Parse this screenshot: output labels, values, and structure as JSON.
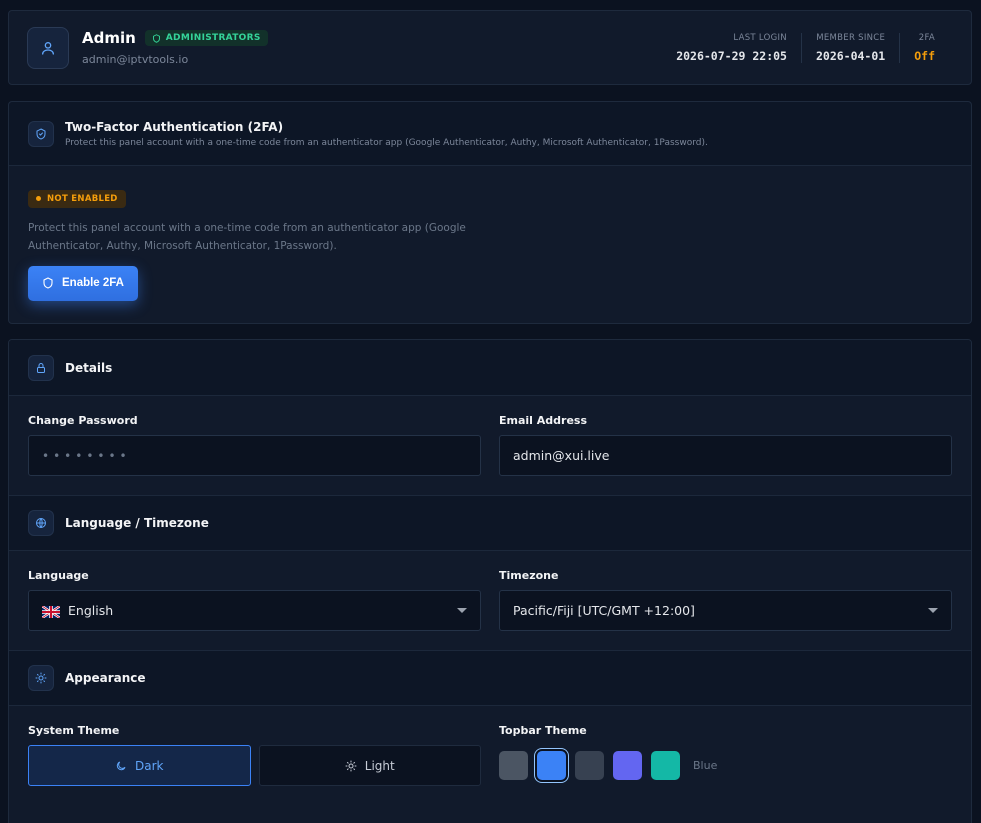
{
  "profile": {
    "name": "Admin",
    "role": "ADMINISTRATORS",
    "email": "admin@iptvtools.io",
    "stats": [
      {
        "label": "LAST LOGIN",
        "value": "2026-07-29 22:05"
      },
      {
        "label": "MEMBER SINCE",
        "value": "2026-04-01"
      },
      {
        "label": "2FA",
        "value": "Off"
      }
    ]
  },
  "tfa": {
    "title": "Two-Factor Authentication (2FA)",
    "description": "Protect this panel account with a one-time code from an authenticator app (Google Authenticator, Authy, Microsoft Authenticator, 1Password).",
    "status": "NOT ENABLED",
    "body_text": "Protect this panel account with a one-time code from an authenticator app (Google Authenticator, Authy, Microsoft Authenticator, 1Password).",
    "button_label": "Enable 2FA"
  },
  "details": {
    "title": "Details",
    "password_label": "Change Password",
    "password_value": "••••••••",
    "email_label": "Email Address",
    "email_value": "admin@xui.live"
  },
  "locale": {
    "title": "Language / Timezone",
    "language_label": "Language",
    "language_value": "English",
    "timezone_label": "Timezone",
    "timezone_value": "Pacific/Fiji [UTC/GMT +12:00]"
  },
  "appearance": {
    "title": "Appearance",
    "system_theme_label": "System Theme",
    "dark_label": "Dark",
    "light_label": "Light",
    "topbar_theme_label": "Topbar Theme",
    "swatches": [
      {
        "name": "gray",
        "color": "#4b5563"
      },
      {
        "name": "blue",
        "color": "#3b82f6"
      },
      {
        "name": "slate",
        "color": "#374151"
      },
      {
        "name": "indigo",
        "color": "#6366f1"
      },
      {
        "name": "teal",
        "color": "#14b8a6"
      }
    ],
    "selected_swatch_label": "Blue"
  },
  "colors": {
    "accent": "#3b82f6",
    "success": "#34d399",
    "warning": "#f59e0b"
  }
}
